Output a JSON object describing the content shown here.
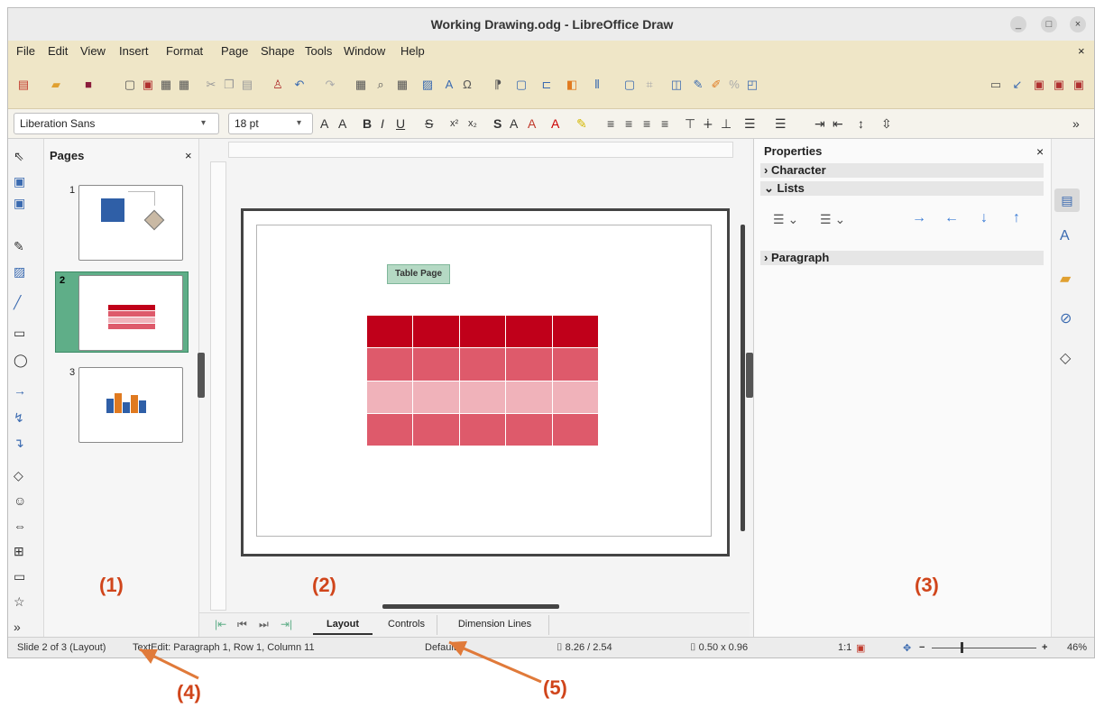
{
  "window": {
    "title": "Working Drawing.odg - LibreOffice Draw",
    "buttons": [
      "_",
      "□",
      "×"
    ]
  },
  "menubar": {
    "items": [
      "File",
      "Edit",
      "View",
      "Insert",
      "Format",
      "Page",
      "Shape",
      "Tools",
      "Window",
      "Help"
    ],
    "close": "×"
  },
  "format_toolbar": {
    "font_name": "Liberation Sans",
    "font_size": "18 pt",
    "overflow": "»"
  },
  "pages_panel": {
    "title": "Pages",
    "close": "×",
    "thumbnails": [
      {
        "number": "1",
        "selected": false
      },
      {
        "number": "2",
        "selected": true
      },
      {
        "number": "3",
        "selected": false
      }
    ]
  },
  "drawing": {
    "text_box": "Table Page",
    "table": {
      "rows": 4,
      "cols": 5,
      "row_colors": [
        "#c0001a",
        "#de5a6b",
        "#f0b2ba",
        "#de5a6b"
      ]
    }
  },
  "layer_tabs": [
    "Layout",
    "Controls",
    "Dimension Lines"
  ],
  "properties": {
    "title": "Properties",
    "close": "×",
    "menu": "≡",
    "sections": [
      "Character",
      "Lists",
      "Paragraph"
    ]
  },
  "status": {
    "slide": "Slide 2 of 3 (Layout)",
    "textedit": "TextEdit: Paragraph 1, Row 1, Column 11",
    "style": "Default",
    "position": "8.26 / 2.54",
    "size": "0.50 x 0.96",
    "scale": "1:1",
    "zoom": "46%"
  },
  "callouts": [
    "(1)",
    "(2)",
    "(3)",
    "(4)",
    "(5)"
  ],
  "colors": {
    "accent_selected": "#5fae88",
    "callout": "#d0451b"
  }
}
